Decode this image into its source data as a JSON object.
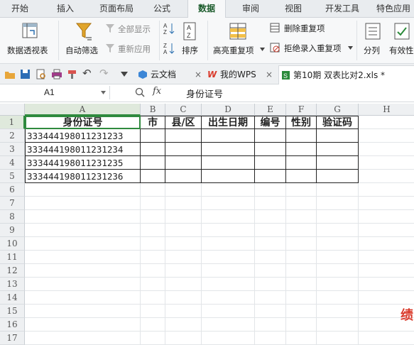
{
  "menu": {
    "tabs": [
      "开始",
      "插入",
      "页面布局",
      "公式",
      "数据",
      "审阅",
      "视图",
      "开发工具",
      "特色应用"
    ],
    "active": "数据"
  },
  "ribbon": {
    "pivot": "数据透视表",
    "autofilter": "自动筛选",
    "show_all": "全部显示",
    "reapply": "重新应用",
    "sort": "排序",
    "highlight_dup": "高亮重复项",
    "remove_dup": "删除重复项",
    "reject_dup": "拒绝录入重复项",
    "split": "分列",
    "validity": "有效性"
  },
  "doc_tabs": [
    "云文档",
    "我的WPS",
    "第10期 双表比对2.xls *"
  ],
  "formula_bar": {
    "name_box": "A1",
    "fx": "fx",
    "content": "身份证号"
  },
  "columns": [
    "A",
    "B",
    "C",
    "D",
    "E",
    "F",
    "G",
    "H"
  ],
  "rows": [
    "1",
    "2",
    "3",
    "4",
    "5",
    "6",
    "7",
    "8",
    "9",
    "10",
    "11",
    "12",
    "13",
    "14",
    "15",
    "16",
    "17"
  ],
  "table": {
    "headers": [
      "身份证号",
      "市",
      "县/区",
      "出生日期",
      "编号",
      "性别",
      "验证码"
    ],
    "ids": [
      "333444198011231233",
      "333444198011231234",
      "333444198011231235",
      "333444198011231236"
    ]
  },
  "corner_text": "绩",
  "colors": {
    "accent": "#1a7f3a",
    "active_tab": "#1a5a2a",
    "corner": "#d93a2b"
  }
}
